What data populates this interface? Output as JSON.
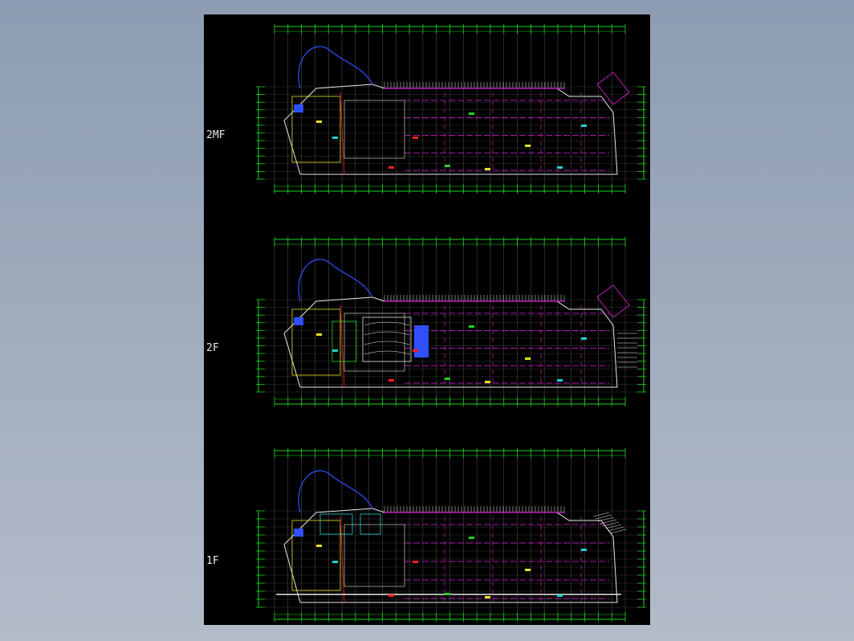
{
  "drawing": {
    "floors": [
      {
        "key": "mezz",
        "label": "2MF"
      },
      {
        "key": "second",
        "label": "2F"
      },
      {
        "key": "first",
        "label": "1F"
      }
    ]
  },
  "colors": {
    "background": "#8d9cb2",
    "sheet": "#000000",
    "grid_green": "#1fd41f",
    "outline_white": "#e8e8e8",
    "wall_magenta": "#e020e0",
    "path_blue": "#3050ff",
    "accent_yellow": "#e8e020",
    "accent_red": "#ff2020",
    "accent_cyan": "#20d0d0"
  }
}
